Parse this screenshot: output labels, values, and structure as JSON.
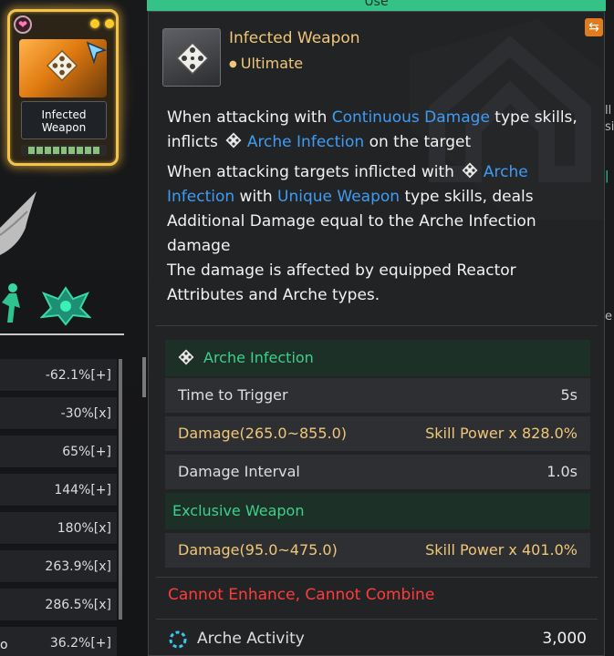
{
  "tab": {
    "use_label": "Use"
  },
  "card": {
    "name_line1": "Infected",
    "name_line2": "Weapon",
    "heart_icon": "heart-icon",
    "accent": "#f2c44a"
  },
  "left_stats": [
    "-62.1%[+]",
    "-30%[x]",
    "65%[+]",
    "144%[+]",
    "180%[x]",
    "263.9%[x]",
    "286.5%[x]",
    "36.2%[+]"
  ],
  "left_stray_text": "o",
  "right_fragments": [
    "ll",
    "si",
    "|",
    "e"
  ],
  "tooltip": {
    "title": "Infected Weapon",
    "grade": "Ultimate",
    "description": {
      "p1_a": "When attacking with ",
      "p1_kw": "Continuous Damage",
      "p1_b": " type skills,",
      "p2_a": "inflicts",
      "p2_kw": "Arche Infection",
      "p2_b": " on the target",
      "p3_a": "When attacking targets inflicted with",
      "p3_kw1": "Arche",
      "p3_kw2": "Infection",
      "p3_b": " with ",
      "p3_kw3": "Unique Weapon",
      "p3_c": " type skills, deals",
      "p4": "Additional Damage equal to the Arche Infection",
      "p5": "damage",
      "p6": "The damage is affected by equipped Reactor",
      "p7": "Attributes and Arche types."
    },
    "arche_infection": {
      "header": "Arche Infection",
      "rows": [
        {
          "label": "Time to Trigger",
          "value": "5s"
        },
        {
          "label": "Damage(265.0~855.0)",
          "value": "Skill Power x 828.0%"
        },
        {
          "label": "Damage Interval",
          "value": "1.0s"
        }
      ]
    },
    "exclusive": {
      "header": "Exclusive Weapon",
      "rows": [
        {
          "label": "Damage(95.0~475.0)",
          "value": "Skill Power x 401.0%"
        }
      ]
    },
    "warning": "Cannot Enhance, Cannot Combine",
    "activity": {
      "label": "Arche Activity",
      "value": "3,000"
    }
  },
  "colors": {
    "title_gold": "#f0c778",
    "keyword_blue": "#3f9cf4",
    "green": "#3ed08b",
    "warning_red": "#ff3c3c",
    "tab_green": "#35c286"
  }
}
